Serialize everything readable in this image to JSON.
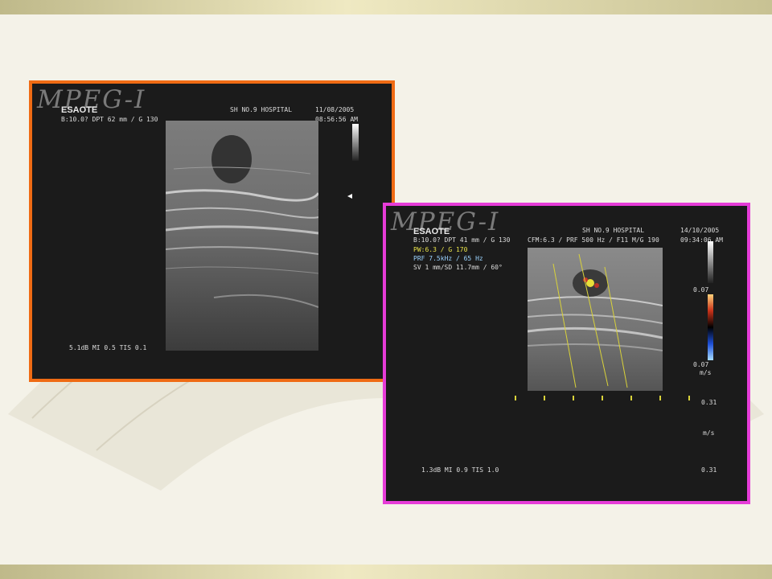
{
  "left_panel": {
    "logo": "MPEG-I",
    "brand": "ESAOTE",
    "params": "B:10.0?  DPT 62 mm / G 130",
    "hospital": "SH NO.9 HOSPITAL",
    "date": "11/08/2005",
    "time": "08:56:56 AM",
    "bottom_params": "5.1dB MI 0.5 TIS 0.1",
    "border_color": "#ef6b14"
  },
  "right_panel": {
    "logo": "MPEG-I",
    "brand": "ESAOTE",
    "params": "B:10.0?  DPT 41 mm / G 130",
    "cfm": "CFM:6.3 / PRF 500 Hz / F11 M/G 190",
    "hospital": "SH NO.9 HOSPITAL",
    "date": "14/10/2005",
    "time": "09:34:06 AM",
    "pw": "PW:6.3 / G 170",
    "prf": "PRF 7.5kHz / 65 Hz",
    "sv": "SV 1 mm/SD 11.7mm / 60°",
    "scale_top": "0.07",
    "scale_bottom": "0.07",
    "scale_unit": "m/s",
    "doppler_val_1": "0.31",
    "doppler_unit": "m/s",
    "doppler_val_2": "0.31",
    "bottom_params": "1.3dB MI 0.9 TIS 1.0",
    "border_color": "#e63cd8"
  }
}
